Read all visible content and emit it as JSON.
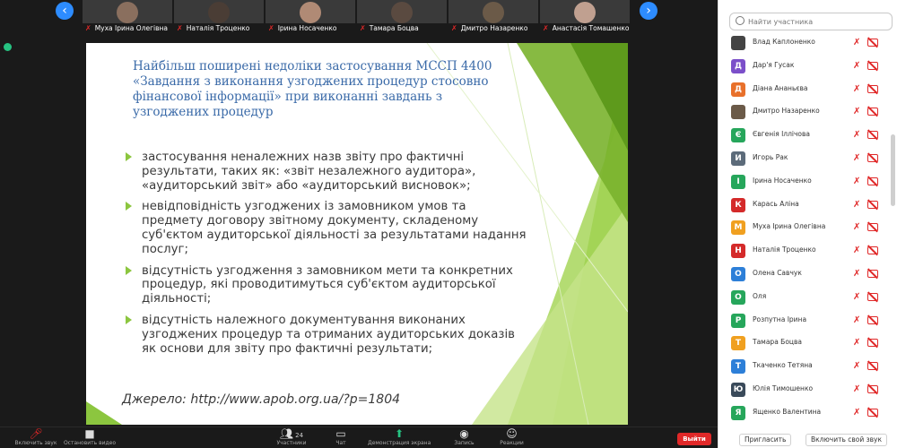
{
  "thumbnails": [
    {
      "name": "Муха Ірина Олегівна"
    },
    {
      "name": "Наталія Троценко"
    },
    {
      "name": "Ірина Носаченко"
    },
    {
      "name": "Тамара Боцва"
    },
    {
      "name": "Дмитро Назаренко"
    },
    {
      "name": "Анастасія Томашенко"
    }
  ],
  "slide": {
    "title": "Найбільш поширені недоліки застосування МССП 4400 «Завдання з виконання узгоджених процедур стосовно фінансової інформації» при виконанні завдань з узгоджених процедур",
    "bullets": [
      "застосування неналежних назв звіту про фактичні результати, таких як: «звіт незалежного аудитора», «аудиторський звіт» або «аудиторський висновок»;",
      "невідповідність узгоджених із замовником умов та предмету договору звітному документу, складеному суб'єктом аудиторської діяльності за результатами надання послуг;",
      "відсутність узгодження з замовником мети та конкретних процедур, які проводитимуться суб'єктом аудиторської діяльності;",
      "відсутність належного документування виконаних узгоджених процедур та отриманих аудиторських доказів як основи для звіту про фактичні результати;"
    ],
    "source": "Джерело: http://www.apob.org.ua/?p=1804"
  },
  "panel": {
    "search_placeholder": "Найти участника",
    "participants": [
      {
        "name": "Влад Каплоненко",
        "initial": "",
        "color": "#444444"
      },
      {
        "name": "Дар'я Гусак",
        "initial": "Д",
        "color": "#7b4fc9"
      },
      {
        "name": "Діана Ананьєва",
        "initial": "Д",
        "color": "#e8702a"
      },
      {
        "name": "Дмитро Назаренко",
        "initial": "",
        "color": "#6b5a48"
      },
      {
        "name": "Євгенія Іллічова",
        "initial": "Є",
        "color": "#26a65b"
      },
      {
        "name": "Игорь Рак",
        "initial": "И",
        "color": "#5c6b7a"
      },
      {
        "name": "Ірина Носаченко",
        "initial": "І",
        "color": "#26a65b"
      },
      {
        "name": "Карась Аліна",
        "initial": "К",
        "color": "#d42a2a"
      },
      {
        "name": "Муха Ірина Олегівна",
        "initial": "М",
        "color": "#f0a020"
      },
      {
        "name": "Наталія Троценко",
        "initial": "Н",
        "color": "#d42a2a"
      },
      {
        "name": "Олена Савчук",
        "initial": "О",
        "color": "#2d7fd8"
      },
      {
        "name": "Оля",
        "initial": "О",
        "color": "#26a65b"
      },
      {
        "name": "Розпутна Ірина",
        "initial": "Р",
        "color": "#26a65b"
      },
      {
        "name": "Тамара Боцва",
        "initial": "Т",
        "color": "#f0a020"
      },
      {
        "name": "Ткаченко Тетяна",
        "initial": "Т",
        "color": "#2d7fd8"
      },
      {
        "name": "Юлія Тимошенко",
        "initial": "Ю",
        "color": "#3a4a5a"
      },
      {
        "name": "Ященко Валентина",
        "initial": "Я",
        "color": "#26a65b"
      }
    ],
    "invite_label": "Пригласить",
    "unmute_label": "Включить свой звук"
  },
  "toolbar": {
    "mic_label": "Включить звук",
    "video_label": "Остановить видео",
    "participants_count": "24",
    "participants_label": "Участники",
    "chat_label": "Чат",
    "share_label": "Демонстрация экрана",
    "record_label": "Запись",
    "reactions_label": "Реакции",
    "leave_label": "Выйти"
  }
}
